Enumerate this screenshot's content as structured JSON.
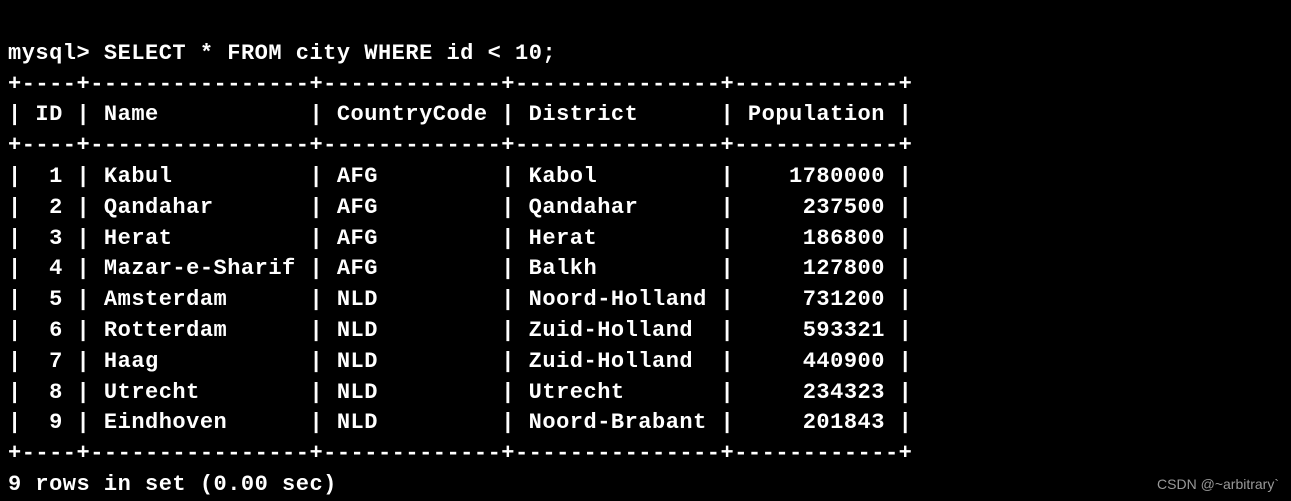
{
  "prompt": "mysql>",
  "query": "SELECT * FROM city WHERE id < 10;",
  "divider_top": "+----+----------------+-------------+---------------+------------+",
  "divider_mid": "+----+----------------+-------------+---------------+------------+",
  "divider_bot": "+----+----------------+-------------+---------------+------------+",
  "header_line": "| ID | Name           | CountryCode | District      | Population |",
  "columns": [
    "ID",
    "Name",
    "CountryCode",
    "District",
    "Population"
  ],
  "row_lines": [
    "|  1 | Kabul          | AFG         | Kabol         |    1780000 |",
    "|  2 | Qandahar       | AFG         | Qandahar      |     237500 |",
    "|  3 | Herat          | AFG         | Herat         |     186800 |",
    "|  4 | Mazar-e-Sharif | AFG         | Balkh         |     127800 |",
    "|  5 | Amsterdam      | NLD         | Noord-Holland |     731200 |",
    "|  6 | Rotterdam      | NLD         | Zuid-Holland  |     593321 |",
    "|  7 | Haag           | NLD         | Zuid-Holland  |     440900 |",
    "|  8 | Utrecht        | NLD         | Utrecht       |     234323 |",
    "|  9 | Eindhoven      | NLD         | Noord-Brabant |     201843 |"
  ],
  "rows": [
    {
      "ID": 1,
      "Name": "Kabul",
      "CountryCode": "AFG",
      "District": "Kabol",
      "Population": 1780000
    },
    {
      "ID": 2,
      "Name": "Qandahar",
      "CountryCode": "AFG",
      "District": "Qandahar",
      "Population": 237500
    },
    {
      "ID": 3,
      "Name": "Herat",
      "CountryCode": "AFG",
      "District": "Herat",
      "Population": 186800
    },
    {
      "ID": 4,
      "Name": "Mazar-e-Sharif",
      "CountryCode": "AFG",
      "District": "Balkh",
      "Population": 127800
    },
    {
      "ID": 5,
      "Name": "Amsterdam",
      "CountryCode": "NLD",
      "District": "Noord-Holland",
      "Population": 731200
    },
    {
      "ID": 6,
      "Name": "Rotterdam",
      "CountryCode": "NLD",
      "District": "Zuid-Holland",
      "Population": 593321
    },
    {
      "ID": 7,
      "Name": "Haag",
      "CountryCode": "NLD",
      "District": "Zuid-Holland",
      "Population": 440900
    },
    {
      "ID": 8,
      "Name": "Utrecht",
      "CountryCode": "NLD",
      "District": "Utrecht",
      "Population": 234323
    },
    {
      "ID": 9,
      "Name": "Eindhoven",
      "CountryCode": "NLD",
      "District": "Noord-Brabant",
      "Population": 201843
    }
  ],
  "footer": "9 rows in set (0.00 sec)",
  "watermark": "CSDN @~arbitrary`"
}
